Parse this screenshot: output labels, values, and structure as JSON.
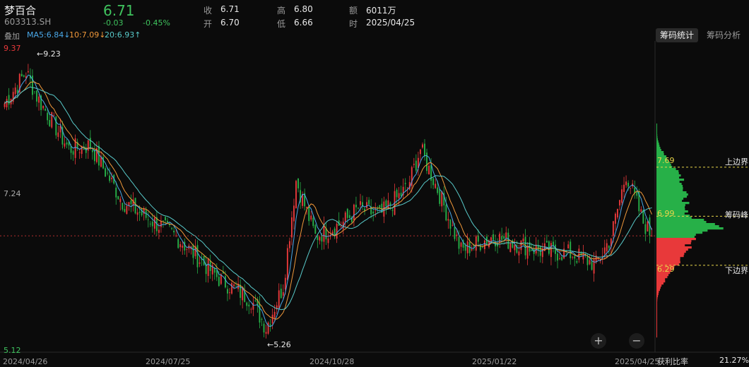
{
  "header": {
    "name": "梦百合",
    "code": "603313.SH",
    "price": "6.71",
    "change": "-0.03",
    "change_pct": "-0.45%",
    "stats": [
      {
        "label": "收",
        "value": "6.71"
      },
      {
        "label": "高",
        "value": "6.80"
      },
      {
        "label": "额",
        "value": "6011万"
      },
      {
        "label": "开",
        "value": "6.70"
      },
      {
        "label": "低",
        "value": "6.66"
      },
      {
        "label": "时",
        "value": "2025/04/25"
      }
    ]
  },
  "ma_bar": {
    "overlay": "叠加",
    "ma5": "MA5:6.84↓",
    "ma10": "10:7.09↓",
    "ma20": "20:6.93↑"
  },
  "tabs": {
    "chip_stats": "筹码统计",
    "chip_analysis": "筹码分析"
  },
  "chip_panel": {
    "upper_value": "7.69",
    "upper_label": "上边界",
    "peak_value": "6.99",
    "peak_label": "筹码峰",
    "lower_value": "6.29",
    "lower_label": "下边界",
    "profit_label": "获利比率",
    "profit_value": "21.27%"
  },
  "colors": {
    "up": "#e8393a",
    "down": "#27b048",
    "ma5": "#4aa8e8",
    "ma10": "#f0983a",
    "ma20": "#58c9c9",
    "bg": "#0b0b0b"
  },
  "chart_data": {
    "type": "candlestick",
    "y_axis_labels": [
      "9.37",
      "7.24",
      "5.12"
    ],
    "ylim": [
      5.12,
      9.37
    ],
    "x_axis_labels": [
      "2024/04/26",
      "2024/07/25",
      "2024/10/28",
      "2025/01/22",
      "2025/04/25"
    ],
    "annotations": [
      {
        "text": "←9.23",
        "x": "2024/05/10",
        "y": 9.23
      },
      {
        "text": "←5.26",
        "x": "2024/09/23",
        "y": 5.26
      }
    ],
    "close_anchors": [
      {
        "i": 0,
        "c": 8.6
      },
      {
        "i": 10,
        "c": 9.05
      },
      {
        "i": 15,
        "c": 8.7
      },
      {
        "i": 30,
        "c": 7.95
      },
      {
        "i": 40,
        "c": 8.0
      },
      {
        "i": 55,
        "c": 7.2
      },
      {
        "i": 80,
        "c": 6.7
      },
      {
        "i": 100,
        "c": 6.1
      },
      {
        "i": 115,
        "c": 5.8
      },
      {
        "i": 122,
        "c": 5.4
      },
      {
        "i": 130,
        "c": 6.0
      },
      {
        "i": 136,
        "c": 7.5
      },
      {
        "i": 145,
        "c": 6.7
      },
      {
        "i": 158,
        "c": 6.9
      },
      {
        "i": 165,
        "c": 7.1
      },
      {
        "i": 175,
        "c": 7.0
      },
      {
        "i": 188,
        "c": 7.4
      },
      {
        "i": 194,
        "c": 7.95
      },
      {
        "i": 203,
        "c": 7.3
      },
      {
        "i": 213,
        "c": 6.5
      },
      {
        "i": 228,
        "c": 6.7
      },
      {
        "i": 250,
        "c": 6.5
      },
      {
        "i": 265,
        "c": 6.45
      },
      {
        "i": 276,
        "c": 6.3
      },
      {
        "i": 283,
        "c": 6.7
      },
      {
        "i": 290,
        "c": 7.6
      },
      {
        "i": 298,
        "c": 6.9
      },
      {
        "i": 302,
        "c": 6.71
      }
    ]
  }
}
